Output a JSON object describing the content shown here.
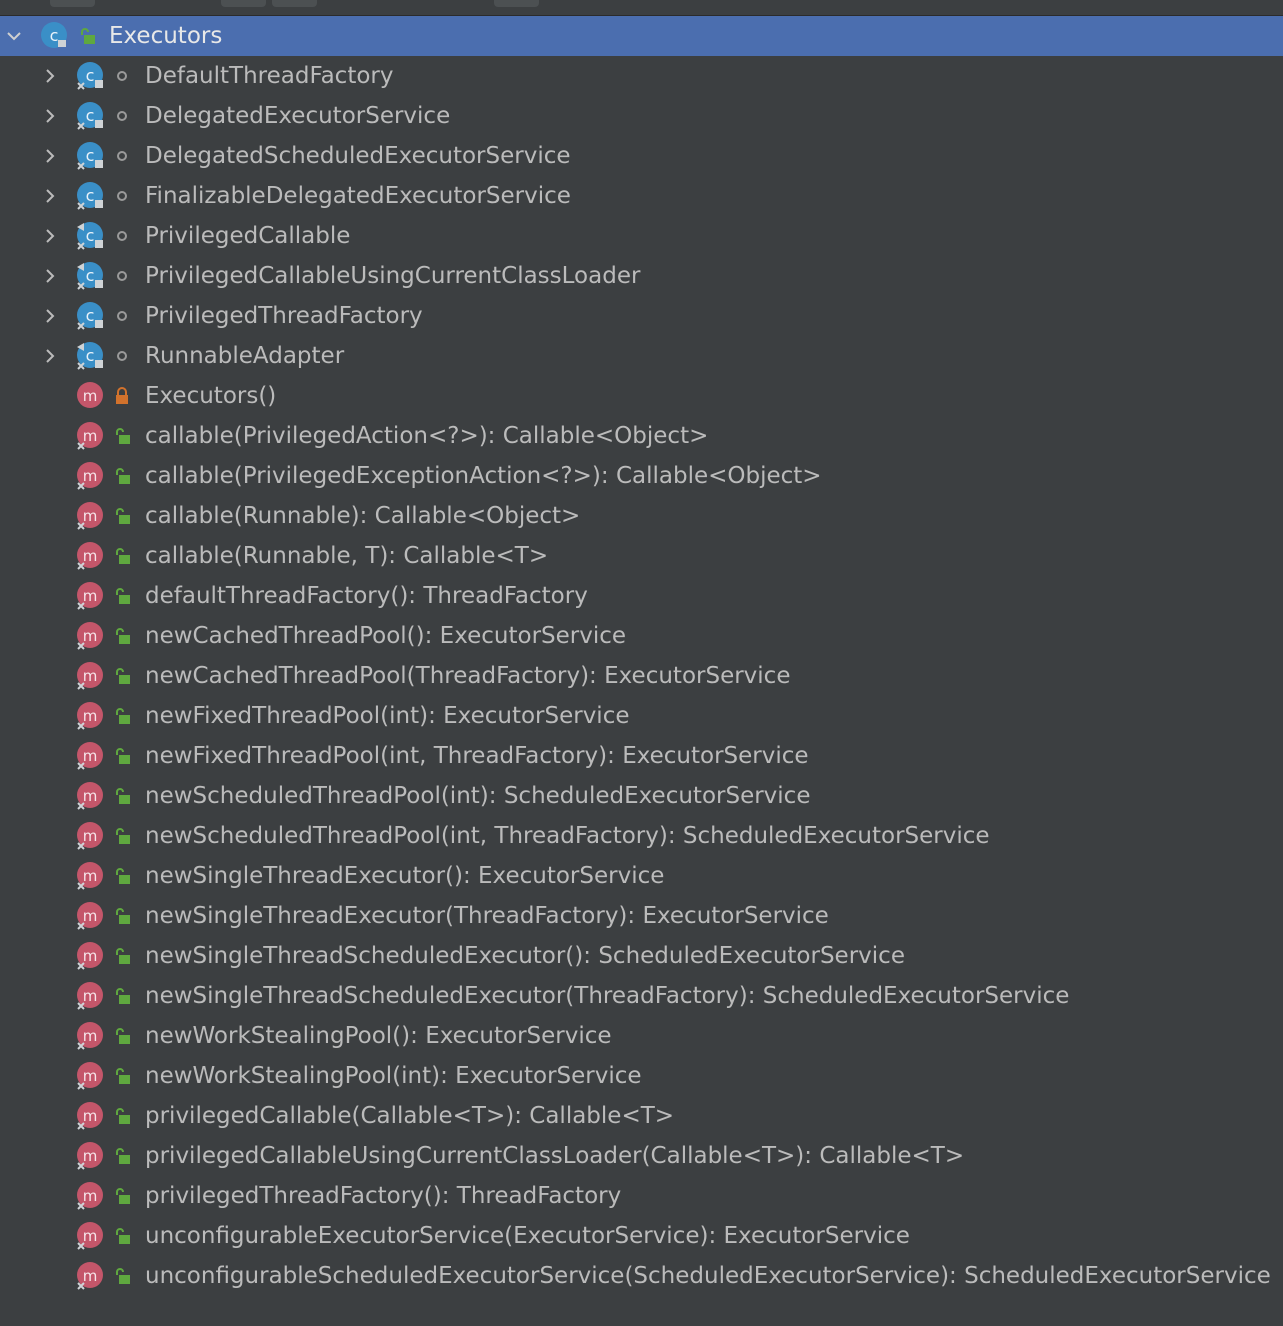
{
  "colors": {
    "background": "#3c3f41",
    "selection": "#4b6eaf",
    "text": "#bbbbbb",
    "class_icon": "#3a8fc7",
    "method_icon": "#c4566a",
    "public_lock": "#5fa83f",
    "private_lock": "#d2722c",
    "package_dot": "#9a9a9a"
  },
  "root": {
    "label": "Executors",
    "icon": "class-icon",
    "visibility": "public-lock-icon",
    "expanded": true
  },
  "classes": [
    {
      "label": "DefaultThreadFactory",
      "icon": "static-class-icon",
      "visibility": "package-private-icon"
    },
    {
      "label": "DelegatedExecutorService",
      "icon": "static-class-icon",
      "visibility": "package-private-icon"
    },
    {
      "label": "DelegatedScheduledExecutorService",
      "icon": "static-class-icon",
      "visibility": "package-private-icon"
    },
    {
      "label": "FinalizableDelegatedExecutorService",
      "icon": "static-class-icon",
      "visibility": "package-private-icon"
    },
    {
      "label": "PrivilegedCallable",
      "icon": "final-static-class-icon",
      "visibility": "package-private-icon"
    },
    {
      "label": "PrivilegedCallableUsingCurrentClassLoader",
      "icon": "final-static-class-icon",
      "visibility": "package-private-icon"
    },
    {
      "label": "PrivilegedThreadFactory",
      "icon": "static-class-icon",
      "visibility": "package-private-icon"
    },
    {
      "label": "RunnableAdapter",
      "icon": "final-static-class-icon",
      "visibility": "package-private-icon"
    }
  ],
  "methods": [
    {
      "label": "Executors()",
      "icon": "method-icon",
      "visibility": "private-lock-icon"
    },
    {
      "label": "callable(PrivilegedAction<?>): Callable<Object>",
      "icon": "static-method-icon",
      "visibility": "public-lock-icon"
    },
    {
      "label": "callable(PrivilegedExceptionAction<?>): Callable<Object>",
      "icon": "static-method-icon",
      "visibility": "public-lock-icon"
    },
    {
      "label": "callable(Runnable): Callable<Object>",
      "icon": "static-method-icon",
      "visibility": "public-lock-icon"
    },
    {
      "label": "callable(Runnable, T): Callable<T>",
      "icon": "static-method-icon",
      "visibility": "public-lock-icon"
    },
    {
      "label": "defaultThreadFactory(): ThreadFactory",
      "icon": "static-method-icon",
      "visibility": "public-lock-icon"
    },
    {
      "label": "newCachedThreadPool(): ExecutorService",
      "icon": "static-method-icon",
      "visibility": "public-lock-icon"
    },
    {
      "label": "newCachedThreadPool(ThreadFactory): ExecutorService",
      "icon": "static-method-icon",
      "visibility": "public-lock-icon"
    },
    {
      "label": "newFixedThreadPool(int): ExecutorService",
      "icon": "static-method-icon",
      "visibility": "public-lock-icon"
    },
    {
      "label": "newFixedThreadPool(int, ThreadFactory): ExecutorService",
      "icon": "static-method-icon",
      "visibility": "public-lock-icon"
    },
    {
      "label": "newScheduledThreadPool(int): ScheduledExecutorService",
      "icon": "static-method-icon",
      "visibility": "public-lock-icon"
    },
    {
      "label": "newScheduledThreadPool(int, ThreadFactory): ScheduledExecutorService",
      "icon": "static-method-icon",
      "visibility": "public-lock-icon"
    },
    {
      "label": "newSingleThreadExecutor(): ExecutorService",
      "icon": "static-method-icon",
      "visibility": "public-lock-icon"
    },
    {
      "label": "newSingleThreadExecutor(ThreadFactory): ExecutorService",
      "icon": "static-method-icon",
      "visibility": "public-lock-icon"
    },
    {
      "label": "newSingleThreadScheduledExecutor(): ScheduledExecutorService",
      "icon": "static-method-icon",
      "visibility": "public-lock-icon"
    },
    {
      "label": "newSingleThreadScheduledExecutor(ThreadFactory): ScheduledExecutorService",
      "icon": "static-method-icon",
      "visibility": "public-lock-icon"
    },
    {
      "label": "newWorkStealingPool(): ExecutorService",
      "icon": "static-method-icon",
      "visibility": "public-lock-icon"
    },
    {
      "label": "newWorkStealingPool(int): ExecutorService",
      "icon": "static-method-icon",
      "visibility": "public-lock-icon"
    },
    {
      "label": "privilegedCallable(Callable<T>): Callable<T>",
      "icon": "static-method-icon",
      "visibility": "public-lock-icon"
    },
    {
      "label": "privilegedCallableUsingCurrentClassLoader(Callable<T>): Callable<T>",
      "icon": "static-method-icon",
      "visibility": "public-lock-icon"
    },
    {
      "label": "privilegedThreadFactory(): ThreadFactory",
      "icon": "static-method-icon",
      "visibility": "public-lock-icon"
    },
    {
      "label": "unconfigurableExecutorService(ExecutorService): ExecutorService",
      "icon": "static-method-icon",
      "visibility": "public-lock-icon"
    },
    {
      "label": "unconfigurableScheduledExecutorService(ScheduledExecutorService): ScheduledExecutorService",
      "icon": "static-method-icon",
      "visibility": "public-lock-icon"
    }
  ]
}
